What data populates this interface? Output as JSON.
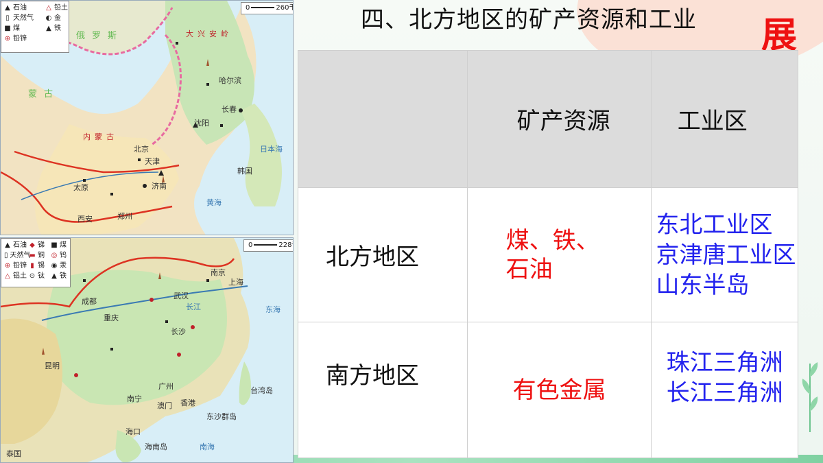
{
  "title": "四、北方地区的矿产资源和工业",
  "badge": "展",
  "map_north": {
    "legend": [
      [
        "石油",
        "铅土"
      ],
      [
        "天然气",
        "金"
      ],
      [
        "煤",
        "铁"
      ],
      [
        "铅锌",
        ""
      ]
    ],
    "legend_icons": [
      [
        "oil-derrick-icon",
        "bauxite-icon"
      ],
      [
        "gas-icon",
        "gold-icon"
      ],
      [
        "coal-icon",
        "iron-icon"
      ],
      [
        "lead-zinc-icon",
        ""
      ]
    ],
    "scale_label": "260千米",
    "scale_zero": "0",
    "labels": {
      "russia": "俄罗斯",
      "mongolia": "蒙古",
      "beijing": "北京",
      "tianjin": "天津",
      "shenyang": "沈阳",
      "harbin": "哈尔滨",
      "changchun": "长春",
      "taiyuan": "太原",
      "jinan": "济南",
      "zhengzhou": "郑州",
      "xian": "西安",
      "yellow_sea": "黄海",
      "sea_of_japan": "日本海",
      "korea": "韩国",
      "daxing": "大兴安岭",
      "inner_mongolia": "内蒙古"
    }
  },
  "map_south": {
    "legend": [
      [
        "石油",
        "锑",
        "煤"
      ],
      [
        "天然气",
        "铜",
        "钨"
      ],
      [
        "铅锌",
        "锡",
        "汞"
      ],
      [
        "铝土",
        "钛",
        "铁"
      ]
    ],
    "legend_icons": [
      [
        "oil-derrick-icon",
        "antimony-icon",
        "coal-icon"
      ],
      [
        "gas-icon",
        "copper-icon",
        "tungsten-icon"
      ],
      [
        "lead-zinc-icon",
        "tin-icon",
        "mercury-icon"
      ],
      [
        "bauxite-icon",
        "titanium-icon",
        "iron-icon"
      ]
    ],
    "scale_label": "228千米",
    "scale_zero": "0",
    "labels": {
      "shanghai": "上海",
      "nanjing": "南京",
      "wuhan": "武汉",
      "chengdu": "成都",
      "chongqing": "重庆",
      "changsha": "长沙",
      "kunming": "昆明",
      "guangzhou": "广州",
      "hongkong": "香港",
      "macau": "澳门",
      "nanning": "南宁",
      "haikou": "海口",
      "hainan": "海南岛",
      "taiwan": "台湾岛",
      "east_sea": "东海",
      "south_sea": "南海",
      "dongsha": "东沙群岛",
      "thailand": "泰国",
      "changjiang": "长江"
    }
  },
  "table": {
    "headers": [
      "",
      "矿产资源",
      "工业区"
    ],
    "rows": [
      {
        "region": "北方地区",
        "minerals": [
          "煤、铁、",
          "石油"
        ],
        "industry": [
          "东北工业区",
          "京津唐工业区",
          "山东半岛"
        ]
      },
      {
        "region": "南方地区",
        "minerals": [
          "有色金属"
        ],
        "industry": [
          "珠江三角洲",
          "长江三角洲"
        ]
      }
    ]
  },
  "colors": {
    "mineral_text": "#ee1111",
    "industry_text": "#2222ee",
    "header_bg": "#dcdcdc",
    "badge": "#ee1111"
  }
}
